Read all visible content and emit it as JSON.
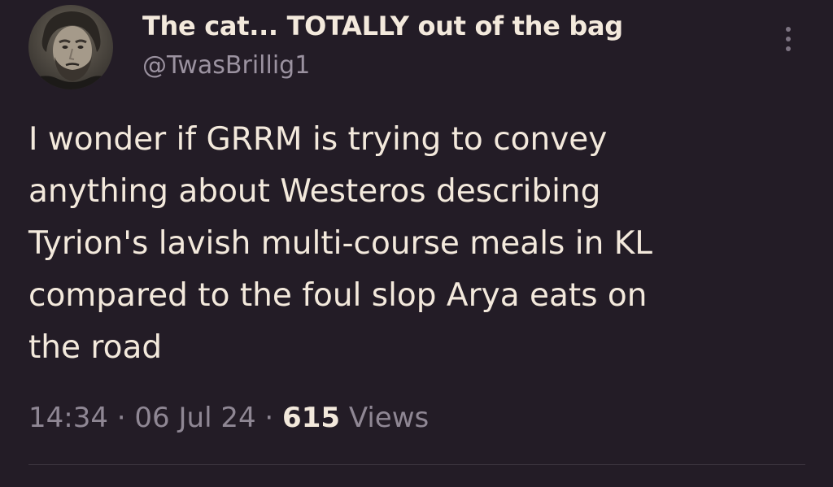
{
  "user": {
    "display_name": "The cat... TOTALLY out of the bag",
    "handle": "@TwasBrillig1"
  },
  "tweet": {
    "lines": [
      "I wonder if GRRM is trying to convey",
      "anything about Westeros describing",
      "Tyrion's lavish multi-course meals in KL",
      "compared to the foul slop Arya eats on",
      "the road"
    ]
  },
  "meta": {
    "time": "14:34",
    "separator": "·",
    "date": "06 Jul 24",
    "views_count": "615",
    "views_label": "Views"
  },
  "icons": {
    "more": "more-vertical-icon"
  },
  "colors": {
    "background": "#231c26",
    "text": "#f3e9dc",
    "secondary": "#9b92a0"
  }
}
